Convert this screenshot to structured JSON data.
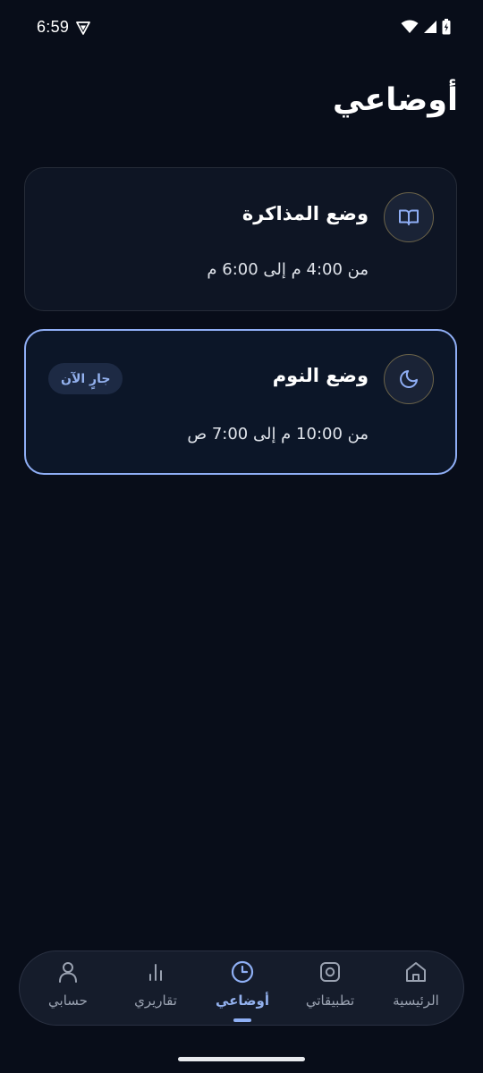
{
  "status_bar": {
    "time": "6:59"
  },
  "page": {
    "title": "أوضاعي"
  },
  "modes": [
    {
      "title": "وضع المذاكرة",
      "schedule": "من 4:00 م إلى 6:00 م",
      "icon": "book-open-icon",
      "active": false
    },
    {
      "title": "وضع النوم",
      "schedule": "من 10:00 م إلى 7:00 ص",
      "icon": "moon-icon",
      "active": true,
      "badge": "جارٍ الآن"
    }
  ],
  "bottom_nav": {
    "items": [
      {
        "label": "الرئيسية",
        "icon": "home-icon",
        "active": false
      },
      {
        "label": "تطبيقاتي",
        "icon": "apps-icon",
        "active": false
      },
      {
        "label": "أوضاعي",
        "icon": "clock-icon",
        "active": true
      },
      {
        "label": "تقاريري",
        "icon": "bar-chart-icon",
        "active": false
      },
      {
        "label": "حسابي",
        "icon": "person-icon",
        "active": false
      }
    ]
  },
  "colors": {
    "background": "#080d19",
    "card": "#0e1524",
    "accent": "#8faef5",
    "muted_text": "#9aa2b1"
  }
}
